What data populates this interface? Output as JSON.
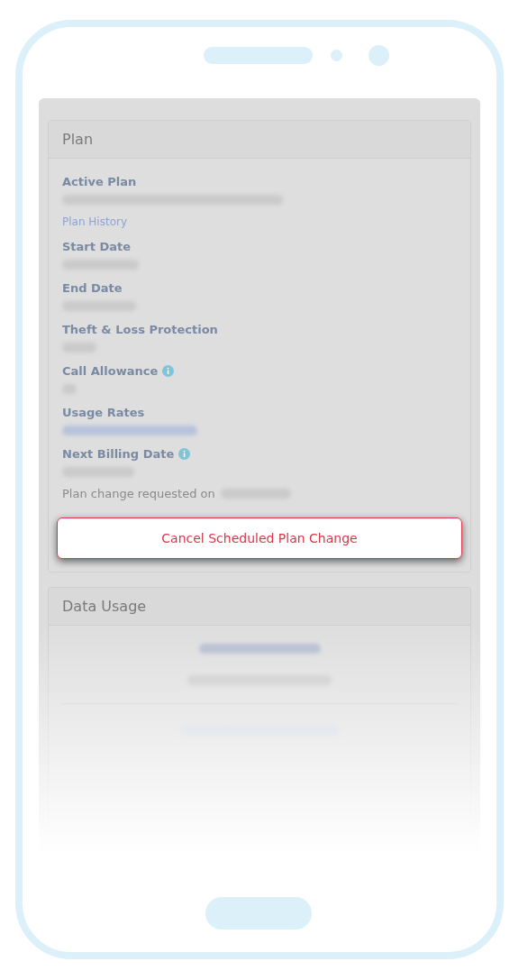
{
  "plan_card": {
    "title": "Plan",
    "fields": [
      {
        "label": "Active Plan",
        "info": false,
        "link": "Plan History"
      },
      {
        "label": "Start Date",
        "info": false
      },
      {
        "label": "End Date",
        "info": false
      },
      {
        "label": "Theft & Loss Protection",
        "info": false
      },
      {
        "label": "Call Allowance",
        "info": true
      },
      {
        "label": "Usage Rates",
        "info": false
      },
      {
        "label": "Next Billing Date",
        "info": true
      }
    ],
    "change_note": "Plan change requested on",
    "cancel_button": "Cancel Scheduled Plan Change"
  },
  "data_usage_card": {
    "title": "Data Usage"
  }
}
